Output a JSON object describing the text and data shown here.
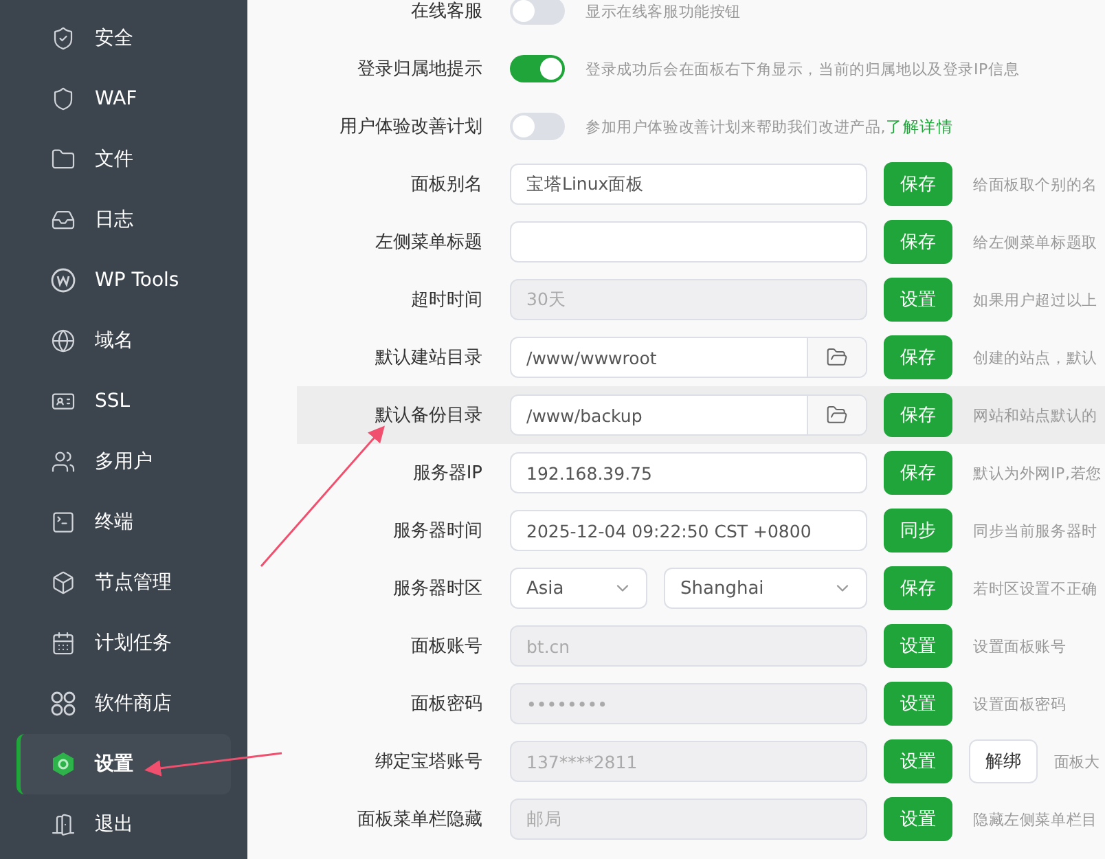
{
  "sidebar": {
    "items": [
      {
        "label": "安全",
        "selected": false
      },
      {
        "label": "WAF",
        "selected": false
      },
      {
        "label": "文件",
        "selected": false
      },
      {
        "label": "日志",
        "selected": false
      },
      {
        "label": "WP Tools",
        "selected": false
      },
      {
        "label": "域名",
        "selected": false
      },
      {
        "label": "SSL",
        "selected": false
      },
      {
        "label": "多用户",
        "selected": false
      },
      {
        "label": "终端",
        "selected": false
      },
      {
        "label": "节点管理",
        "selected": false
      },
      {
        "label": "计划任务",
        "selected": false
      },
      {
        "label": "软件商店",
        "selected": false
      },
      {
        "label": "设置",
        "selected": true
      },
      {
        "label": "退出",
        "selected": false
      }
    ]
  },
  "settings": [
    {
      "kind": "toggle",
      "label": "在线客服",
      "on": false,
      "description": "显示在线客服功能按钮"
    },
    {
      "kind": "toggle",
      "label": "登录归属地提示",
      "on": true,
      "description": "登录成功后会在面板右下角显示，当前的归属地以及登录IP信息"
    },
    {
      "kind": "toggle",
      "label": "用户体验改善计划",
      "on": false,
      "description": "参加用户体验改善计划来帮助我们改进产品,",
      "link": "了解详情"
    },
    {
      "kind": "input",
      "label": "面板别名",
      "value": "宝塔Linux面板",
      "disabled": false,
      "button": "保存",
      "description": "给面板取个别的名"
    },
    {
      "kind": "input",
      "label": "左侧菜单标题",
      "disabled": false,
      "button": "保存",
      "description": "给左侧菜单标题取"
    },
    {
      "kind": "input",
      "label": "超时时间",
      "value": "30天",
      "disabled": true,
      "button": "设置",
      "description": "如果用户超过以上"
    },
    {
      "kind": "path",
      "label": "默认建站目录",
      "value": "/www/wwwroot",
      "button": "保存",
      "description": "创建的站点，默认"
    },
    {
      "kind": "path",
      "label": "默认备份目录",
      "value": "/www/backup",
      "button": "保存",
      "description": "网站和站点默认的",
      "highlighted": true
    },
    {
      "kind": "input",
      "label": "服务器IP",
      "value": "192.168.39.75",
      "disabled": false,
      "button": "保存",
      "description": "默认为外网IP,若您"
    },
    {
      "kind": "input",
      "label": "服务器时间",
      "value": "2025-12-04 09:22:50 CST +0800",
      "disabled": false,
      "button": "同步",
      "description": "同步当前服务器时"
    },
    {
      "kind": "select",
      "label": "服务器时区",
      "region": "Asia",
      "city": "Shanghai",
      "button": "保存",
      "description": "若时区设置不正确"
    },
    {
      "kind": "input",
      "label": "面板账号",
      "value": "bt.cn",
      "disabled": true,
      "button": "设置",
      "description": "设置面板账号"
    },
    {
      "kind": "input",
      "label": "面板密码",
      "value": "••••••••",
      "disabled": true,
      "button": "设置",
      "description": "设置面板密码"
    },
    {
      "kind": "input",
      "label": "绑定宝塔账号",
      "value": "137****2811",
      "disabled": true,
      "button": "设置",
      "extra_button": "解绑",
      "description": "面板大"
    },
    {
      "kind": "input",
      "label": "面板菜单栏隐藏",
      "value": "邮局",
      "disabled": true,
      "button": "设置",
      "description": "隐藏左侧菜单栏目"
    }
  ]
}
